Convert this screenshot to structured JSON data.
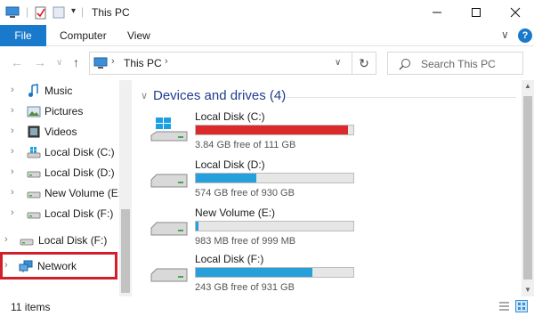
{
  "window": {
    "title": "This PC"
  },
  "ribbon": {
    "file_label": "File",
    "tabs": [
      "Computer",
      "View"
    ],
    "help_label": "?"
  },
  "address": {
    "location": "This PC",
    "search_placeholder": "Search This PC"
  },
  "nav": {
    "items": [
      {
        "label": "Music",
        "icon": "music-icon"
      },
      {
        "label": "Pictures",
        "icon": "pictures-icon"
      },
      {
        "label": "Videos",
        "icon": "videos-icon"
      },
      {
        "label": "Local Disk (C:)",
        "icon": "windows-drive-icon"
      },
      {
        "label": "Local Disk (D:)",
        "icon": "drive-icon"
      },
      {
        "label": "New Volume (E:)",
        "icon": "drive-icon"
      },
      {
        "label": "Local Disk (F:)",
        "icon": "drive-icon"
      },
      {
        "label": "Local Disk (F:)",
        "icon": "drive-icon"
      },
      {
        "label": "Network",
        "icon": "network-icon"
      }
    ]
  },
  "content": {
    "group_title": "Devices and drives (4)",
    "drives": [
      {
        "name": "Local Disk (C:)",
        "free": "3.84 GB free of 111 GB",
        "used_fraction": 0.966,
        "bar_color": "#da2a2a",
        "icon": "windows-drive-icon"
      },
      {
        "name": "Local Disk (D:)",
        "free": "574 GB free of 930 GB",
        "used_fraction": 0.383,
        "bar_color": "#26a0da",
        "icon": "drive-icon"
      },
      {
        "name": "New Volume (E:)",
        "free": "983 MB free of 999 MB",
        "used_fraction": 0.016,
        "bar_color": "#26a0da",
        "icon": "drive-icon"
      },
      {
        "name": "Local Disk (F:)",
        "free": "243 GB free of 931 GB",
        "used_fraction": 0.739,
        "bar_color": "#26a0da",
        "icon": "drive-icon"
      }
    ]
  },
  "status": {
    "items_count": "11 items"
  },
  "colors": {
    "accent": "#1979ca",
    "highlight": "#d21f2b",
    "header_text": "#1e3d8f"
  }
}
